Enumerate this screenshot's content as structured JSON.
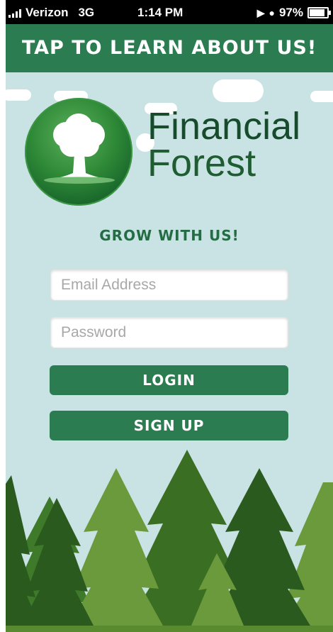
{
  "status_bar": {
    "carrier": "Verizon",
    "network": "3G",
    "time": "1:14 PM",
    "battery": "97%",
    "battery_level": 0.97,
    "icons": [
      "signal-bars-icon",
      "location-arrow-icon",
      "alarm-clock-icon",
      "battery-icon"
    ]
  },
  "banner": {
    "label": "TAP TO LEARN ABOUT US!"
  },
  "logo": {
    "line1": "Financial",
    "line2": "Forest",
    "icon": "tree-icon"
  },
  "tagline": "GROW WITH US!",
  "form": {
    "email": {
      "value": "",
      "placeholder": "Email Address"
    },
    "password": {
      "value": "",
      "placeholder": "Password"
    }
  },
  "buttons": {
    "login": "LOGIN",
    "signup": "SIGN UP"
  },
  "colors": {
    "primary_green": "#2b7d51",
    "sky": "#c9e3e4",
    "brand_text": "#164b2c",
    "tree_dark": "#2a5a1e",
    "tree_mid": "#3f7a2a",
    "tree_light": "#6b9a3c",
    "trunk": "#6b3a1c"
  },
  "scene_icons": [
    "cloud-icon",
    "pine-tree-icon"
  ]
}
